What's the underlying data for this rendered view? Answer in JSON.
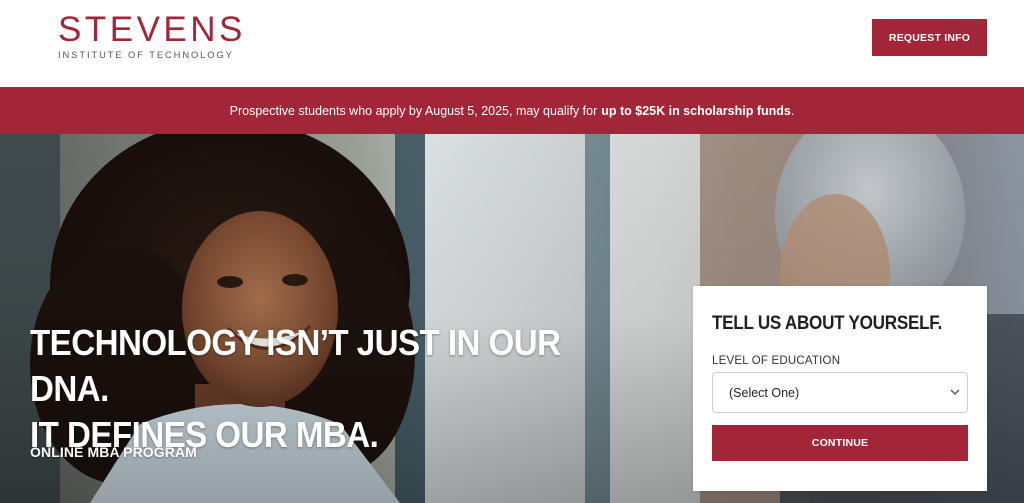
{
  "brand": {
    "name": "STEVENS",
    "subtitle": "INSTITUTE OF TECHNOLOGY",
    "color_primary": "#a32638",
    "color_gray": "#54585a"
  },
  "header": {
    "request_button": "REQUEST INFO"
  },
  "banner": {
    "text": "Prospective students who apply by August 5, 2025, may qualify for",
    "highlight": "up to $25K in scholarship funds",
    "end": "."
  },
  "hero": {
    "headline_line1": "TECHNOLOGY ISN’T JUST IN OUR DNA.",
    "headline_line2": "IT DEFINES OUR MBA.",
    "program": "ONLINE MBA PROGRAM"
  },
  "form": {
    "title": "TELL US ABOUT YOURSELF.",
    "education_label": "LEVEL OF EDUCATION",
    "education_value": "(Select One)",
    "chevron_icon": "chevron-down-icon",
    "continue": "CONTINUE"
  }
}
